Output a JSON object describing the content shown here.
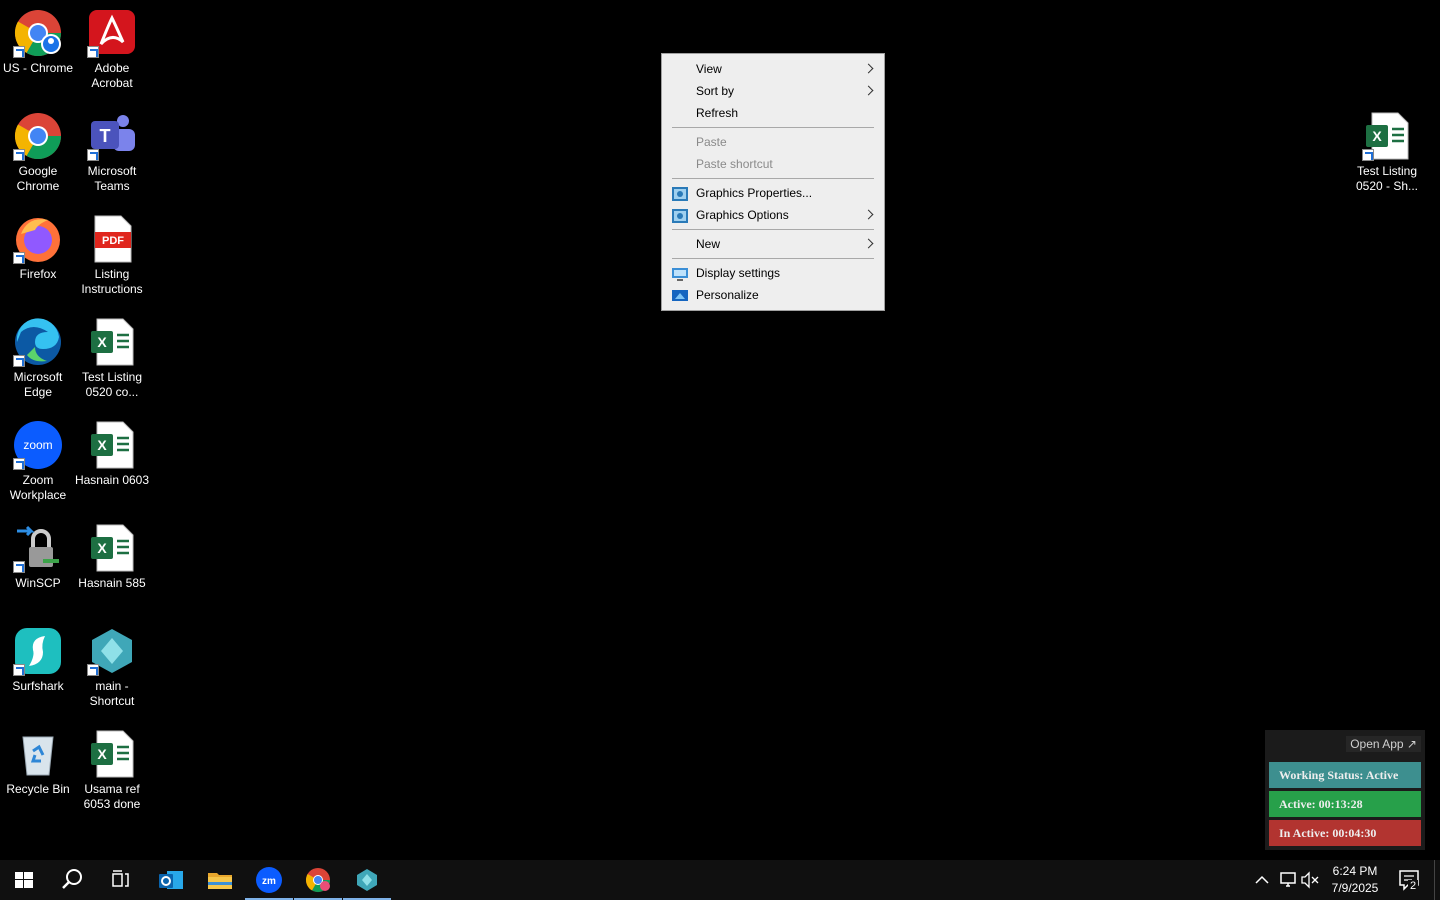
{
  "desktop": {
    "icons": [
      {
        "label": "US - Chrome",
        "icon": "chrome-profile-icon"
      },
      {
        "label": "Adobe\nAcrobat",
        "icon": "acrobat-icon"
      },
      {
        "label": "Google\nChrome",
        "icon": "chrome-icon"
      },
      {
        "label": "Microsoft\nTeams",
        "icon": "teams-icon"
      },
      {
        "label": "Firefox",
        "icon": "firefox-icon"
      },
      {
        "label": "Listing\nInstructions",
        "icon": "pdf-icon"
      },
      {
        "label": "Microsoft\nEdge",
        "icon": "edge-icon"
      },
      {
        "label": "Test Listing\n0520 co...",
        "icon": "excel-icon"
      },
      {
        "label": "Zoom\nWorkplace",
        "icon": "zoom-icon"
      },
      {
        "label": "Hasnain 0603",
        "icon": "excel-icon"
      },
      {
        "label": "WinSCP",
        "icon": "winscp-icon"
      },
      {
        "label": "Hasnain 585",
        "icon": "excel-icon"
      },
      {
        "label": "Surfshark",
        "icon": "surfshark-icon"
      },
      {
        "label": "main -\nShortcut",
        "icon": "app-shortcut-icon"
      },
      {
        "label": "Recycle Bin",
        "icon": "recycle-bin-icon"
      },
      {
        "label": "Usama ref\n6053 done",
        "icon": "excel-icon"
      },
      {
        "label": "Test Listing\n0520 - Sh...",
        "icon": "excel-icon"
      }
    ]
  },
  "context_menu": {
    "view": "View",
    "sort_by": "Sort by",
    "refresh": "Refresh",
    "paste": "Paste",
    "paste_shortcut": "Paste shortcut",
    "graphics_properties": "Graphics Properties...",
    "graphics_options": "Graphics Options",
    "new": "New",
    "display_settings": "Display settings",
    "personalize": "Personalize"
  },
  "widget": {
    "open_app": "Open App ↗",
    "working_status": "Working Status: Active",
    "active": "Active: 00:13:28",
    "inactive": "In Active: 00:04:30",
    "colors": {
      "status": "#3d8f8f",
      "active": "#27a04a",
      "inactive": "#b23430"
    }
  },
  "taskbar": {
    "time": "6:24 PM",
    "date": "7/9/2025",
    "notification_count": "2",
    "apps": [
      "start-icon",
      "search-icon",
      "task-view-icon",
      "outlook-icon",
      "file-explorer-icon",
      "zoom-icon",
      "chrome-icon",
      "app-shortcut-icon"
    ]
  }
}
